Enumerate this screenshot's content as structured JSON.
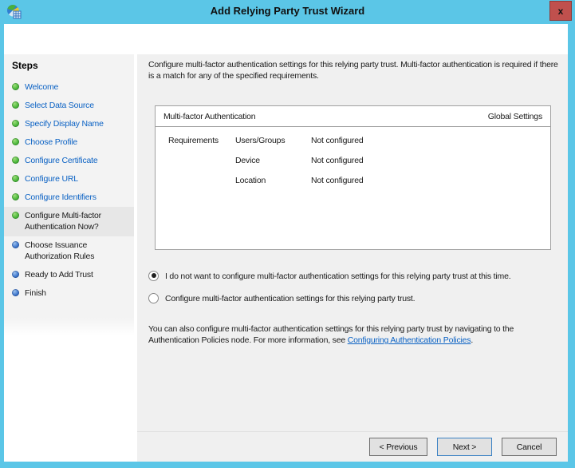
{
  "window": {
    "title": "Add Relying Party Trust Wizard",
    "close_label": "x"
  },
  "colors": {
    "titlebar": "#5bc6e7",
    "close_button": "#c0504d",
    "step_completed_dot": "#4db83c",
    "step_upcoming_dot": "#3f77cc",
    "step_link_text": "#0b62c4",
    "content_background": "#f0f0f0",
    "current_step_highlight": "#e7e7e7"
  },
  "sidebar": {
    "title": "Steps",
    "items": [
      {
        "label": "Welcome",
        "state": "completed"
      },
      {
        "label": "Select Data Source",
        "state": "completed"
      },
      {
        "label": "Specify Display Name",
        "state": "completed"
      },
      {
        "label": "Choose Profile",
        "state": "completed"
      },
      {
        "label": "Configure Certificate",
        "state": "completed"
      },
      {
        "label": "Configure URL",
        "state": "completed"
      },
      {
        "label": "Configure Identifiers",
        "state": "completed"
      },
      {
        "label": "Configure Multi-factor Authentication Now?",
        "state": "current"
      },
      {
        "label": "Choose Issuance Authorization Rules",
        "state": "upcoming"
      },
      {
        "label": "Ready to Add Trust",
        "state": "upcoming"
      },
      {
        "label": "Finish",
        "state": "upcoming"
      }
    ]
  },
  "content": {
    "intro": "Configure multi-factor authentication settings for this relying party trust. Multi-factor authentication is required if there is a match for any of the specified requirements.",
    "mfa_table": {
      "header_left": "Multi-factor Authentication",
      "header_right": "Global Settings",
      "row_group_label": "Requirements",
      "rows": [
        {
          "name": "Users/Groups",
          "value": "Not configured"
        },
        {
          "name": "Device",
          "value": "Not configured"
        },
        {
          "name": "Location",
          "value": "Not configured"
        }
      ]
    },
    "radios": [
      {
        "label": "I do not want to configure multi-factor authentication settings for this relying party trust at this time.",
        "selected": true
      },
      {
        "label": "Configure multi-factor authentication settings for this relying party trust.",
        "selected": false
      }
    ],
    "note": {
      "text_before_link": "You can also configure multi-factor authentication settings for this relying party trust by navigating to the Authentication Policies node. For more information, see ",
      "link_text": "Configuring Authentication Policies",
      "text_after_link": "."
    }
  },
  "footer": {
    "buttons": [
      {
        "label": "< Previous",
        "default": false
      },
      {
        "label": "Next >",
        "default": true
      },
      {
        "label": "Cancel",
        "default": false
      }
    ]
  }
}
